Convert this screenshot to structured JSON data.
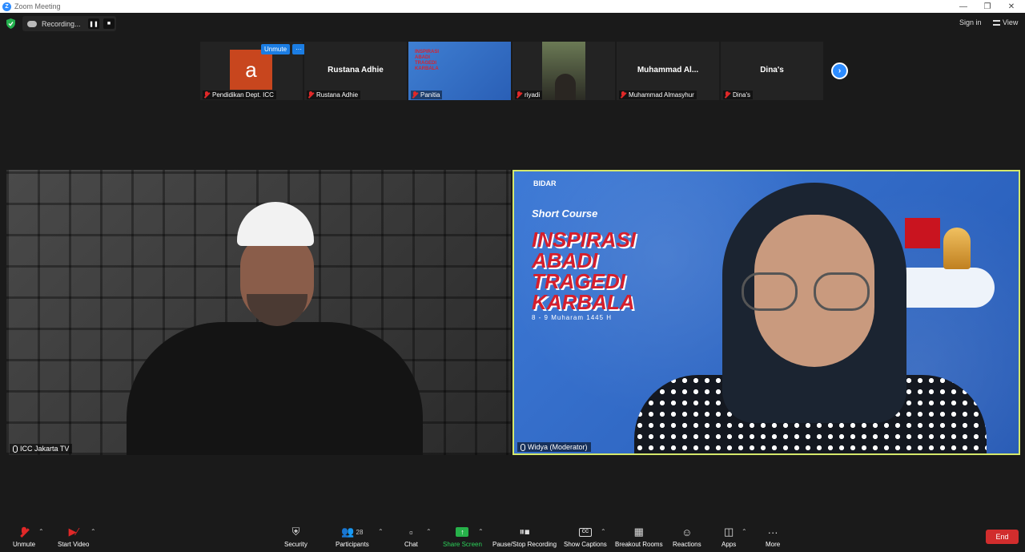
{
  "window": {
    "title": "Zoom Meeting"
  },
  "topbar": {
    "recording_label": "Recording...",
    "sign_in": "Sign in",
    "view": "View"
  },
  "strip": {
    "unmute_label": "Unmute",
    "more_label": "···",
    "avatar_letter": "a",
    "thumbs": [
      {
        "name": "Pendidikan Dept. ICC",
        "big": ""
      },
      {
        "name": "Rustana Adhie",
        "big": "Rustana Adhie"
      },
      {
        "name": "Panitia",
        "big": ""
      },
      {
        "name": "riyadi",
        "big": ""
      },
      {
        "name": "Muhammad Almasyhur",
        "big": "Muhammad  Al..."
      },
      {
        "name": "Dina's",
        "big": "Dina's"
      }
    ],
    "panitia_banner": "INSPIRASI ABADI TRAGEDI KARBALA"
  },
  "videos": {
    "left_name": "ICC Jakarta TV",
    "right_name": "Widya (Moderator)",
    "banner": {
      "logo": "BIDAR",
      "subtitle": "Short Course",
      "title_lines": [
        "INSPIRASI",
        "ABADI",
        "TRAGEDI",
        "KARBALA"
      ],
      "date": "8 - 9 Muharam 1445 H"
    }
  },
  "toolbar": {
    "unmute": "Unmute",
    "start_video": "Start Video",
    "security": "Security",
    "participants": "Participants",
    "participants_count": "28",
    "chat": "Chat",
    "share_screen": "Share Screen",
    "pause_stop": "Pause/Stop Recording",
    "captions": "Show Captions",
    "captions_icon": "CC",
    "breakout": "Breakout Rooms",
    "reactions": "Reactions",
    "apps": "Apps",
    "more": "More",
    "end": "End"
  },
  "colors": {
    "accent": "#2d8cff",
    "end": "#d12d2d",
    "share": "#27b24a",
    "active_speaker_border": "#d5e86b"
  }
}
